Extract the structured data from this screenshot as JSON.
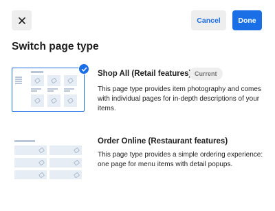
{
  "header": {
    "close_label": "×",
    "cancel_label": "Cancel",
    "done_label": "Done"
  },
  "page": {
    "title": "Switch page type"
  },
  "options": [
    {
      "title": "Shop All (Retail features)",
      "badge": "Current",
      "description": "This page type provides item photography and comes with individual pages for in-depth descriptions of your items.",
      "selected": true,
      "thumbnail_icon": "retail-grid-thumbnail"
    },
    {
      "title": "Order Online (Restaurant features)",
      "description": "This page type provides a simple ordering experience: one page for menu items with detail popups.",
      "selected": false,
      "thumbnail_icon": "restaurant-list-thumbnail"
    }
  ],
  "colors": {
    "accent": "#1a6ee6",
    "button_bg": "#eeeeee",
    "text": "#1e1e1e",
    "muted": "#757575",
    "thumb_block": "#e6edf5"
  }
}
